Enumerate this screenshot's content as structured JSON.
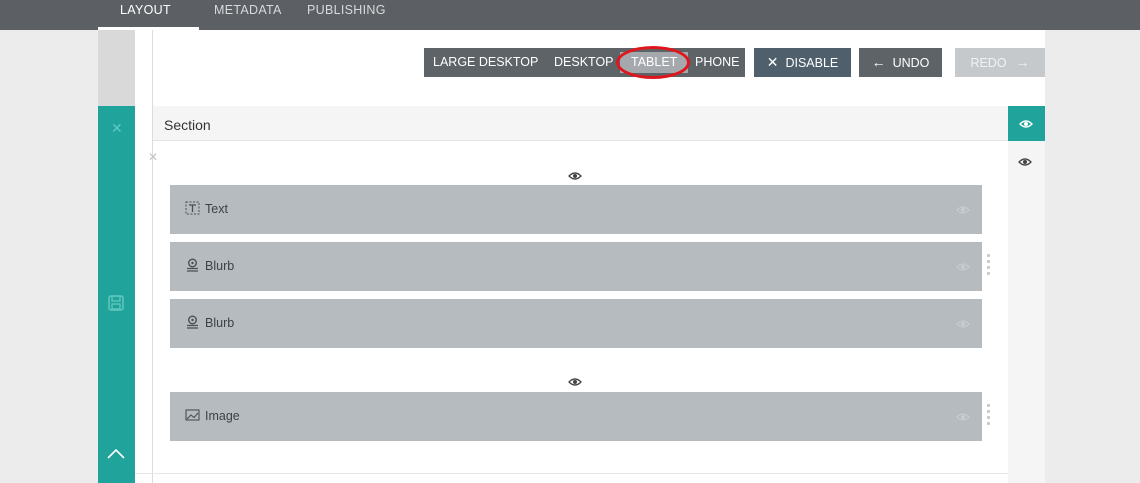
{
  "nav": {
    "tabs": [
      {
        "label": "LAYOUT",
        "active": true
      },
      {
        "label": "METADATA",
        "active": false
      },
      {
        "label": "PUBLISHING",
        "active": false
      }
    ]
  },
  "toolbar": {
    "devices": [
      "LARGE DESKTOP",
      "DESKTOP",
      "TABLET",
      "PHONE"
    ],
    "selected_device": "TABLET",
    "disable_label": "DISABLE",
    "undo_label": "UNDO",
    "redo_label": "REDO"
  },
  "section": {
    "title": "Section"
  },
  "modules": [
    {
      "label": "Text",
      "icon": "text-icon"
    },
    {
      "label": "Blurb",
      "icon": "blurb-icon"
    },
    {
      "label": "Blurb",
      "icon": "blurb-icon"
    },
    {
      "label": "Image",
      "icon": "image-icon"
    }
  ],
  "colors": {
    "accent_teal": "#1fa39a",
    "nav_bg": "#5c5f63",
    "module_bg": "#b6bbbf",
    "highlight_ring": "#e0161d"
  }
}
